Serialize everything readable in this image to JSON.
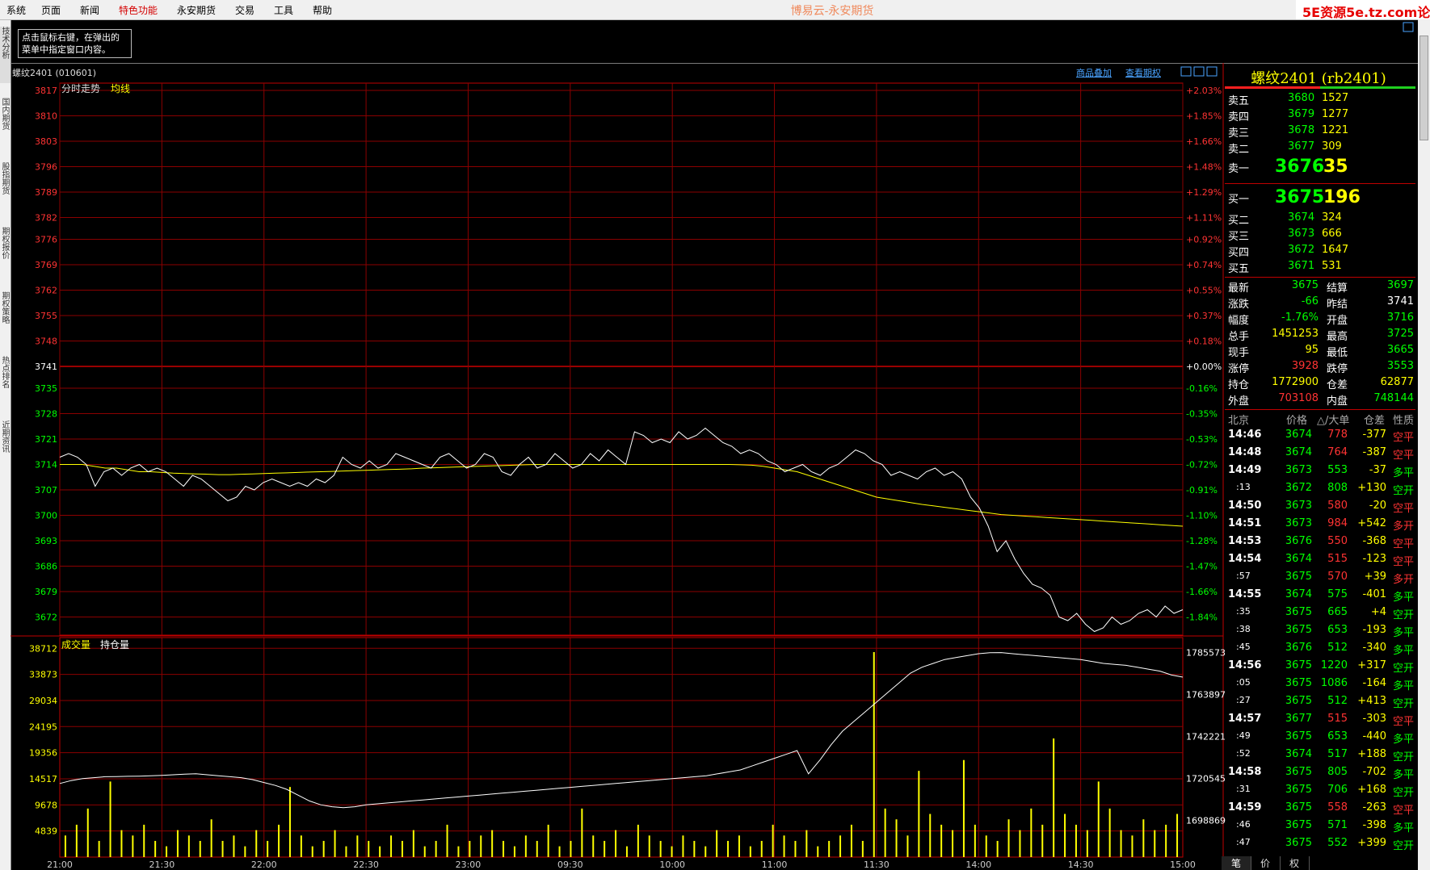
{
  "menu": {
    "items": [
      {
        "label": "系统"
      },
      {
        "label": "页面"
      },
      {
        "label": "新闻"
      },
      {
        "label": "特色功能",
        "highlight": true
      },
      {
        "label": "永安期货"
      },
      {
        "label": "交易"
      },
      {
        "label": "工具"
      },
      {
        "label": "帮助"
      }
    ]
  },
  "app_title": "博易云-永安期货",
  "watermark_text": "5E资源5e.tz.com论坛",
  "left_tabs": [
    "技术分析",
    "国内期货",
    "股指期货",
    "期权报价",
    "期权策略",
    "热点排名",
    "近期资讯"
  ],
  "notice_text": "点击鼠标右键，在弹出的菜单中指定窗口内容。",
  "chart_header": "螺纹2401 (010601)",
  "header_links": [
    "商品叠加",
    "查看期权"
  ],
  "price_panel": {
    "title_a": "分时走势",
    "title_b": "均线"
  },
  "volume_panel": {
    "title_a": "成交量",
    "title_b": "持仓量"
  },
  "right_panel": {
    "title": "螺纹2401 (rb2401)",
    "asks": [
      {
        "label": "卖五",
        "price": "3680",
        "vol": "1527"
      },
      {
        "label": "卖四",
        "price": "3679",
        "vol": "1277"
      },
      {
        "label": "卖三",
        "price": "3678",
        "vol": "1221"
      },
      {
        "label": "卖二",
        "price": "3677",
        "vol": "309"
      },
      {
        "label": "卖一",
        "price": "3676",
        "vol": "35"
      }
    ],
    "bids": [
      {
        "label": "买一",
        "price": "3675",
        "vol": "196"
      },
      {
        "label": "买二",
        "price": "3674",
        "vol": "324"
      },
      {
        "label": "买三",
        "price": "3673",
        "vol": "666"
      },
      {
        "label": "买四",
        "price": "3672",
        "vol": "1647"
      },
      {
        "label": "买五",
        "price": "3671",
        "vol": "531"
      }
    ],
    "stats": [
      {
        "l1": "最新",
        "v1": "3675",
        "c1": "#00ff00",
        "l2": "结算",
        "v2": "3697",
        "c2": "#00ff00"
      },
      {
        "l1": "涨跌",
        "v1": "-66",
        "c1": "#00ff00",
        "l2": "昨结",
        "v2": "3741",
        "c2": "#ffffff"
      },
      {
        "l1": "幅度",
        "v1": "-1.76%",
        "c1": "#00ff00",
        "l2": "开盘",
        "v2": "3716",
        "c2": "#00ff00"
      },
      {
        "l1": "总手",
        "v1": "1451253",
        "c1": "#ffff00",
        "l2": "最高",
        "v2": "3725",
        "c2": "#00ff00"
      },
      {
        "l1": "现手",
        "v1": "95",
        "c1": "#ffff00",
        "l2": "最低",
        "v2": "3665",
        "c2": "#00ff00"
      },
      {
        "l1": "涨停",
        "v1": "3928",
        "c1": "#ff3333",
        "l2": "跌停",
        "v2": "3553",
        "c2": "#00ff00"
      },
      {
        "l1": "持仓",
        "v1": "1772900",
        "c1": "#ffff00",
        "l2": "仓差",
        "v2": "62877",
        "c2": "#ffff00"
      },
      {
        "l1": "外盘",
        "v1": "703108",
        "c1": "#ff3333",
        "l2": "内盘",
        "v2": "748144",
        "c2": "#00ff00"
      }
    ],
    "ticks_header": {
      "time": "北京",
      "price": "价格",
      "vol": "△/大单",
      "diff": "仓差",
      "nature": "性质"
    },
    "ticks": [
      {
        "time": "14:46",
        "price": "3674",
        "vol": "778",
        "diff": "-377",
        "nature": "空平",
        "vc": "#ff3333",
        "nc": "#ff3333"
      },
      {
        "time": "14:48",
        "price": "3674",
        "vol": "764",
        "diff": "-387",
        "nature": "空平",
        "vc": "#ff3333",
        "nc": "#ff3333"
      },
      {
        "time": "14:49",
        "price": "3673",
        "vol": "553",
        "diff": "-37",
        "nature": "多平",
        "vc": "#00ff00",
        "nc": "#00ff00"
      },
      {
        "time": ":13",
        "price": "3672",
        "vol": "808",
        "diff": "+130",
        "nature": "空开",
        "vc": "#00ff00",
        "nc": "#00ff00"
      },
      {
        "time": "14:50",
        "price": "3673",
        "vol": "580",
        "diff": "-20",
        "nature": "空平",
        "vc": "#ff3333",
        "nc": "#ff3333"
      },
      {
        "time": "14:51",
        "price": "3673",
        "vol": "984",
        "diff": "+542",
        "nature": "多开",
        "vc": "#ff3333",
        "nc": "#ff3333"
      },
      {
        "time": "14:53",
        "price": "3676",
        "vol": "550",
        "diff": "-368",
        "nature": "空平",
        "vc": "#ff3333",
        "nc": "#ff3333"
      },
      {
        "time": "14:54",
        "price": "3674",
        "vol": "515",
        "diff": "-123",
        "nature": "空平",
        "vc": "#ff3333",
        "nc": "#ff3333"
      },
      {
        "time": ":57",
        "price": "3675",
        "vol": "570",
        "diff": "+39",
        "nature": "多开",
        "vc": "#ff3333",
        "nc": "#ff3333"
      },
      {
        "time": "14:55",
        "price": "3674",
        "vol": "575",
        "diff": "-401",
        "nature": "多平",
        "vc": "#00ff00",
        "nc": "#00ff00"
      },
      {
        "time": ":35",
        "price": "3675",
        "vol": "665",
        "diff": "+4",
        "nature": "空开",
        "vc": "#00ff00",
        "nc": "#00ff00"
      },
      {
        "time": ":38",
        "price": "3675",
        "vol": "653",
        "diff": "-193",
        "nature": "多平",
        "vc": "#00ff00",
        "nc": "#00ff00"
      },
      {
        "time": ":45",
        "price": "3676",
        "vol": "512",
        "diff": "-340",
        "nature": "多平",
        "vc": "#00ff00",
        "nc": "#00ff00"
      },
      {
        "time": "14:56",
        "price": "3675",
        "vol": "1220",
        "diff": "+317",
        "nature": "空开",
        "vc": "#00ff00",
        "nc": "#00ff00"
      },
      {
        "time": ":05",
        "price": "3675",
        "vol": "1086",
        "diff": "-164",
        "nature": "多平",
        "vc": "#00ff00",
        "nc": "#00ff00"
      },
      {
        "time": ":27",
        "price": "3675",
        "vol": "512",
        "diff": "+413",
        "nature": "空开",
        "vc": "#00ff00",
        "nc": "#00ff00"
      },
      {
        "time": "14:57",
        "price": "3677",
        "vol": "515",
        "diff": "-303",
        "nature": "空平",
        "vc": "#ff3333",
        "nc": "#ff3333"
      },
      {
        "time": ":49",
        "price": "3675",
        "vol": "653",
        "diff": "-440",
        "nature": "多平",
        "vc": "#00ff00",
        "nc": "#00ff00"
      },
      {
        "time": ":52",
        "price": "3674",
        "vol": "517",
        "diff": "+188",
        "nature": "空开",
        "vc": "#00ff00",
        "nc": "#00ff00"
      },
      {
        "time": "14:58",
        "price": "3675",
        "vol": "805",
        "diff": "-702",
        "nature": "多平",
        "vc": "#00ff00",
        "nc": "#00ff00"
      },
      {
        "time": ":31",
        "price": "3675",
        "vol": "706",
        "diff": "+168",
        "nature": "空开",
        "vc": "#00ff00",
        "nc": "#00ff00"
      },
      {
        "time": "14:59",
        "price": "3675",
        "vol": "558",
        "diff": "-263",
        "nature": "空平",
        "vc": "#ff3333",
        "nc": "#ff3333"
      },
      {
        "time": ":46",
        "price": "3675",
        "vol": "571",
        "diff": "-398",
        "nature": "多平",
        "vc": "#00ff00",
        "nc": "#00ff00"
      },
      {
        "time": ":47",
        "price": "3675",
        "vol": "552",
        "diff": "+399",
        "nature": "空开",
        "vc": "#00ff00",
        "nc": "#00ff00"
      }
    ],
    "bottom_tabs": [
      "笔",
      "价",
      "权"
    ]
  },
  "colors": {
    "up": "#ff3333",
    "down": "#00ff00",
    "grid": "#8b0000",
    "price_line": "#ffffff",
    "avg_line": "#ffff00",
    "volume": "#ffff00",
    "oi_line": "#ffffff"
  },
  "chart_data": [
    {
      "type": "line",
      "title": "分时走势",
      "prev_settle": 3741,
      "y_ticks": [
        3817,
        3810,
        3803,
        3796,
        3789,
        3782,
        3776,
        3769,
        3762,
        3755,
        3748,
        3741,
        3735,
        3728,
        3721,
        3714,
        3707,
        3700,
        3693,
        3686,
        3679,
        3672
      ],
      "y_pct_ticks": [
        "+2.03%",
        "+1.85%",
        "+1.66%",
        "+1.48%",
        "+1.29%",
        "+1.11%",
        "+0.92%",
        "+0.74%",
        "+0.55%",
        "+0.37%",
        "+0.18%",
        "+0.00%",
        "-0.16%",
        "-0.35%",
        "-0.53%",
        "-0.72%",
        "-0.91%",
        "-1.10%",
        "-1.28%",
        "-1.47%",
        "-1.66%",
        "-1.84%"
      ],
      "x_ticks": [
        "21:00",
        "21:30",
        "22:00",
        "22:30",
        "23:00",
        "09:30",
        "10:00",
        "11:00",
        "11:30",
        "14:00",
        "14:30",
        "15:00"
      ],
      "ylim": [
        3667,
        3819
      ],
      "series": [
        {
          "name": "分时走势",
          "values": [
            3716,
            3717,
            3716,
            3714,
            3708,
            3712,
            3713,
            3711,
            3713,
            3714,
            3712,
            3713,
            3712,
            3710,
            3708,
            3711,
            3710,
            3708,
            3706,
            3704,
            3705,
            3708,
            3707,
            3709,
            3710,
            3709,
            3708,
            3709,
            3708,
            3710,
            3709,
            3711,
            3716,
            3714,
            3713,
            3715,
            3713,
            3714,
            3717,
            3716,
            3715,
            3714,
            3713,
            3716,
            3717,
            3715,
            3713,
            3714,
            3717,
            3716,
            3712,
            3711,
            3714,
            3716,
            3713,
            3714,
            3717,
            3715,
            3713,
            3714,
            3717,
            3715,
            3718,
            3716,
            3714,
            3723,
            3722,
            3720,
            3721,
            3720,
            3723,
            3721,
            3722,
            3724,
            3722,
            3720,
            3719,
            3717,
            3718,
            3717,
            3715,
            3714,
            3712,
            3713,
            3714,
            3712,
            3711,
            3713,
            3714,
            3716,
            3718,
            3717,
            3715,
            3714,
            3711,
            3712,
            3711,
            3710,
            3712,
            3713,
            3711,
            3712,
            3710,
            3705,
            3702,
            3697,
            3690,
            3693,
            3688,
            3684,
            3681,
            3680,
            3678,
            3672,
            3671,
            3673,
            3670,
            3668,
            3669,
            3672,
            3670,
            3671,
            3673,
            3674,
            3672,
            3675,
            3673,
            3674
          ],
          "color": "#ffffff"
        },
        {
          "name": "均线",
          "values": [
            3714,
            3714,
            3714,
            3713.5,
            3713,
            3713,
            3712.5,
            3712,
            3712,
            3711.8,
            3711.6,
            3711.5,
            3711.4,
            3711.3,
            3711.2,
            3711.2,
            3711.3,
            3711.4,
            3711.5,
            3711.6,
            3711.7,
            3711.8,
            3711.9,
            3712,
            3712.1,
            3712.2,
            3712.3,
            3712.4,
            3712.5,
            3712.6,
            3712.7,
            3712.8,
            3713,
            3713.1,
            3713.2,
            3713.3,
            3713.4,
            3713.5,
            3713.6,
            3713.7,
            3713.8,
            3713.9,
            3714,
            3714,
            3714,
            3714,
            3714,
            3714,
            3714,
            3714,
            3714,
            3714,
            3714,
            3714,
            3714,
            3714,
            3714,
            3714,
            3714,
            3714,
            3713.9,
            3713.8,
            3713.5,
            3713,
            3712.5,
            3712,
            3711,
            3710,
            3709,
            3708,
            3707,
            3706,
            3705,
            3704.5,
            3704,
            3703.5,
            3703,
            3702.6,
            3702.2,
            3701.8,
            3701.4,
            3701,
            3700.6,
            3700.2,
            3700,
            3699.8,
            3699.6,
            3699.4,
            3699.2,
            3699,
            3698.8,
            3698.6,
            3698.4,
            3698.2,
            3698,
            3697.8,
            3697.6,
            3697.4,
            3697.2,
            3697
          ],
          "color": "#ffff00"
        }
      ]
    },
    {
      "type": "bar",
      "title": "成交量",
      "y_ticks": [
        38712,
        33873,
        29034,
        24195,
        19356,
        14517,
        9678,
        4839
      ],
      "oi_ticks": [
        1785573,
        1763897,
        1742221,
        1720545,
        1698869
      ],
      "ylim": [
        0,
        39500
      ],
      "oi_lim": [
        1680000,
        1790000
      ],
      "series": [
        {
          "name": "成交量",
          "values": [
            4000,
            6000,
            9000,
            3000,
            14000,
            5000,
            4000,
            6000,
            3000,
            2000,
            5000,
            4000,
            3000,
            7000,
            3000,
            4000,
            2000,
            5000,
            3000,
            6000,
            13000,
            4000,
            2000,
            3000,
            5000,
            2000,
            4000,
            3000,
            2000,
            4000,
            3000,
            5000,
            2000,
            3000,
            6000,
            2000,
            3000,
            4000,
            5000,
            3000,
            2000,
            4000,
            3000,
            6000,
            2000,
            3000,
            9000,
            4000,
            3000,
            5000,
            2000,
            6000,
            4000,
            3000,
            2000,
            4000,
            3000,
            2000,
            5000,
            3000,
            4000,
            2000,
            3000,
            6000,
            4000,
            3000,
            5000,
            2000,
            3000,
            4000,
            6000,
            3000,
            38000,
            9000,
            7000,
            4000,
            16000,
            8000,
            6000,
            5000,
            18000,
            6000,
            4000,
            3000,
            7000,
            5000,
            9000,
            6000,
            22000,
            8000,
            6000,
            5000,
            14000,
            9000,
            5000,
            4000,
            7000,
            5000,
            6000,
            8000
          ],
          "color": "#ffff00"
        },
        {
          "name": "持仓量",
          "values": [
            1718000,
            1719500,
            1720500,
            1721000,
            1721500,
            1721600,
            1721700,
            1721800,
            1722000,
            1722200,
            1722500,
            1722800,
            1723000,
            1722500,
            1722000,
            1721500,
            1721000,
            1720000,
            1718500,
            1717000,
            1715000,
            1712000,
            1709000,
            1707000,
            1706000,
            1705500,
            1706000,
            1707000,
            1707500,
            1708000,
            1708500,
            1709000,
            1709500,
            1710000,
            1710500,
            1711000,
            1711500,
            1712000,
            1712500,
            1713000,
            1713500,
            1714000,
            1714500,
            1715000,
            1715500,
            1716000,
            1716500,
            1717000,
            1717500,
            1718000,
            1718500,
            1719000,
            1719500,
            1720000,
            1720500,
            1721000,
            1721500,
            1722000,
            1723000,
            1724000,
            1725000,
            1727000,
            1729000,
            1731000,
            1733000,
            1735000,
            1723000,
            1730000,
            1738000,
            1745000,
            1750000,
            1755000,
            1760000,
            1765000,
            1770000,
            1775000,
            1778000,
            1780000,
            1782000,
            1783000,
            1784000,
            1785000,
            1785500,
            1785573,
            1785000,
            1784500,
            1784000,
            1783500,
            1783000,
            1782500,
            1782000,
            1781000,
            1780000,
            1779500,
            1779000,
            1778000,
            1777000,
            1776000,
            1774000,
            1772900
          ],
          "color": "#ffffff"
        }
      ]
    }
  ]
}
